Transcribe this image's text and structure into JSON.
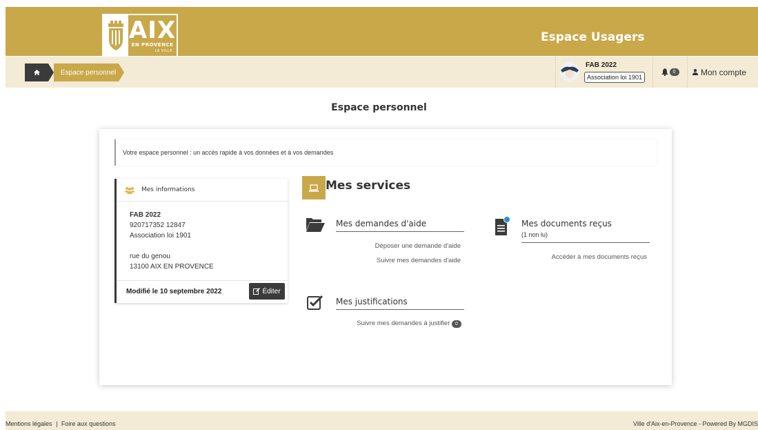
{
  "header": {
    "logo": {
      "main": "AIX",
      "sub": "EN PROVENCE",
      "tagline": "LA VILLE"
    },
    "portal_title": "Espace Usagers"
  },
  "breadcrumb": {
    "home_icon": "home-icon",
    "current": "Espace personnel"
  },
  "account": {
    "name": "FAB 2022",
    "type": "Association loi 1901",
    "notifications_count": "0",
    "menu_label": "Mon compte"
  },
  "page": {
    "title": "Espace personnel",
    "intro": "Votre espace personnel : un accès rapide à vos données et à vos demandes"
  },
  "info_panel": {
    "heading": "Mes informations",
    "name": "FAB 2022",
    "ids": "920717352 12847",
    "type": "Association loi 1901",
    "street": "rue du genou",
    "city": "13100 AIX EN PROVENCE",
    "modified": "Modifié le 10 septembre 2022",
    "edit_label": "Éditer"
  },
  "services": {
    "title": "Mes services",
    "aid": {
      "heading": "Mes demandes d'aide",
      "links": [
        "Déposer une demande d'aide",
        "Suivre mes demandes d'aide"
      ]
    },
    "documents": {
      "heading": "Mes documents reçus",
      "unread": "(1 non lu)",
      "link": "Accéder à mes documents reçus"
    },
    "justifications": {
      "heading": "Mes justifications",
      "link": "Suivre mes demandes à justifier",
      "count": "0"
    }
  },
  "footer": {
    "legal": "Mentions légales",
    "separator": "|",
    "faq": "Foire aux questions",
    "credit": "Ville d'Aix-en-Provence - Powered By MGDIS"
  },
  "colors": {
    "brand_gold": "#c9a84a",
    "light_beige": "#f3ebd5",
    "dark": "#3b3b3b"
  }
}
